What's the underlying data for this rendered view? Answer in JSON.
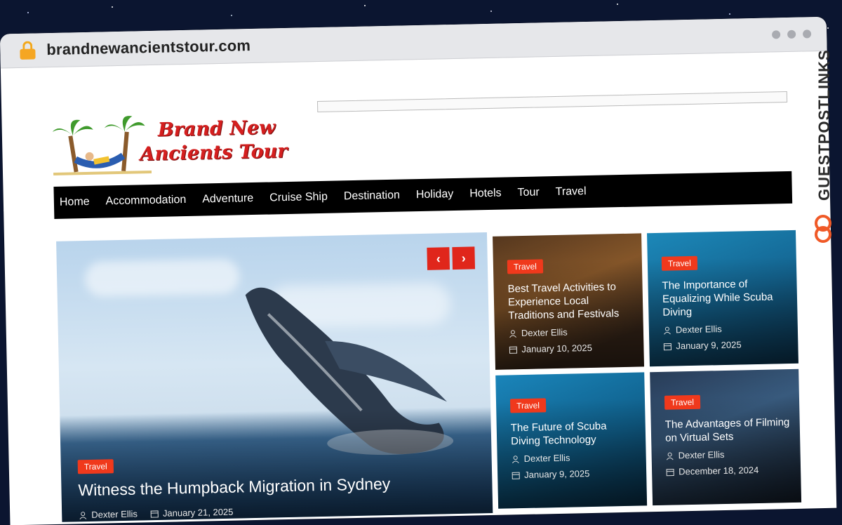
{
  "browser": {
    "url": "brandnewancientstour.com"
  },
  "site": {
    "logo_line1": "Brand New",
    "logo_line2": "Ancients Tour"
  },
  "nav": {
    "items": [
      "Home",
      "Accommodation",
      "Adventure",
      "Cruise Ship",
      "Destination",
      "Holiday",
      "Hotels",
      "Tour",
      "Travel"
    ]
  },
  "hero": {
    "badge": "Travel",
    "title": "Witness the Humpback Migration in Sydney",
    "author": "Dexter Ellis",
    "date": "January 21, 2025",
    "prev_label": "‹",
    "next_label": "›"
  },
  "cards": [
    {
      "badge": "Travel",
      "title": "Best Travel Activities to Experience Local Traditions and Festivals",
      "author": "Dexter Ellis",
      "date": "January 10, 2025"
    },
    {
      "badge": "Travel",
      "title": "The Importance of Equalizing While Scuba Diving",
      "author": "Dexter Ellis",
      "date": "January 9, 2025"
    },
    {
      "badge": "Travel",
      "title": "The Future of Scuba Diving Technology",
      "author": "Dexter Ellis",
      "date": "January 9, 2025"
    },
    {
      "badge": "Travel",
      "title": "The Advantages of Filming on Virtual Sets",
      "author": "Dexter Ellis",
      "date": "December 18, 2024"
    }
  ],
  "watermark": {
    "text": "GUESTPOSTLINKS",
    "color": "#f05a28"
  }
}
